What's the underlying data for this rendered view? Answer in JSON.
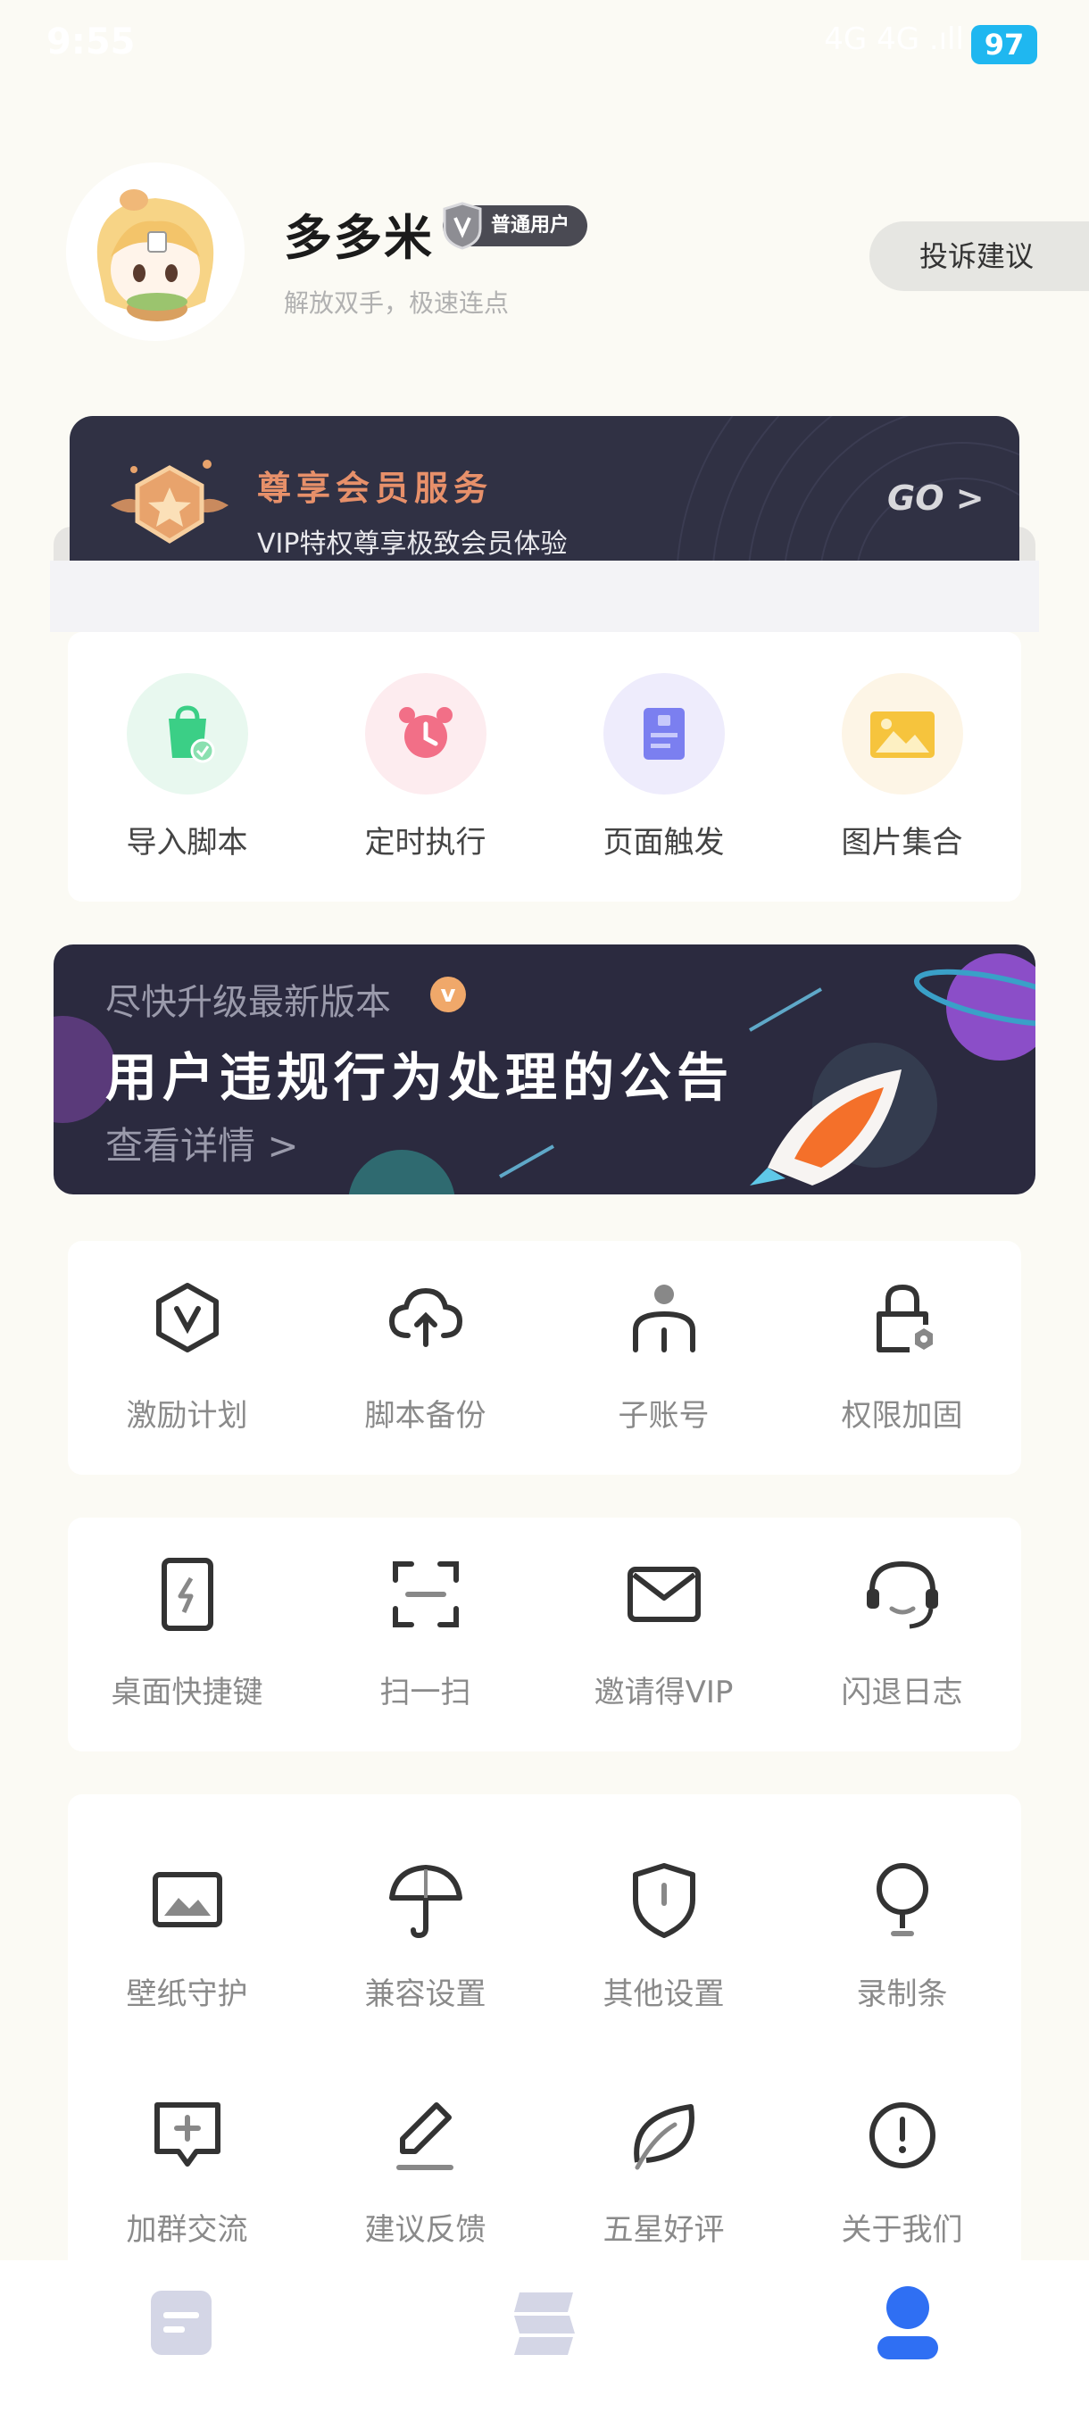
{
  "status_bar": {
    "time": "9:55",
    "signal": "4G 4G .ıll",
    "battery": "97"
  },
  "profile": {
    "username": "多多米",
    "badge": "普通用户",
    "slogan": "解放双手，极速连点",
    "complaint_button": "投诉建议"
  },
  "vip": {
    "title": "尊享会员服务",
    "subtitle": "VIP特权尊享极致会员体验",
    "go": "GO >"
  },
  "quick_actions": [
    {
      "label": "导入脚本",
      "icon": "import-script-icon",
      "bg": "#e8f8ef"
    },
    {
      "label": "定时执行",
      "icon": "alarm-clock-icon",
      "bg": "#fdecef"
    },
    {
      "label": "页面触发",
      "icon": "page-trigger-icon",
      "bg": "#eeecfc"
    },
    {
      "label": "图片集合",
      "icon": "image-collection-icon",
      "bg": "#fdf5e6"
    }
  ],
  "notice": {
    "subtitle": "尽快升级最新版本",
    "vip_mark": "v",
    "title": "用户违规行为处理的公告",
    "link": "查看详情 >"
  },
  "features_row1": [
    {
      "label": "激励计划",
      "icon": "incentive-plan-icon"
    },
    {
      "label": "脚本备份",
      "icon": "cloud-backup-icon"
    },
    {
      "label": "子账号",
      "icon": "sub-account-icon"
    },
    {
      "label": "权限加固",
      "icon": "permission-lock-icon"
    }
  ],
  "features_row2": [
    {
      "label": "桌面快捷键",
      "icon": "desktop-shortcut-icon"
    },
    {
      "label": "扫一扫",
      "icon": "scan-icon"
    },
    {
      "label": "邀请得VIP",
      "icon": "invite-mail-icon"
    },
    {
      "label": "闪退日志",
      "icon": "crash-log-headset-icon"
    }
  ],
  "features_row3": [
    {
      "label": "壁纸守护",
      "icon": "wallpaper-icon"
    },
    {
      "label": "兼容设置",
      "icon": "umbrella-icon"
    },
    {
      "label": "其他设置",
      "icon": "shield-icon"
    },
    {
      "label": "录制条",
      "icon": "record-bar-icon"
    }
  ],
  "features_row4": [
    {
      "label": "加群交流",
      "icon": "group-chat-icon"
    },
    {
      "label": "建议反馈",
      "icon": "edit-feedback-icon"
    },
    {
      "label": "五星好评",
      "icon": "leaf-icon"
    },
    {
      "label": "关于我们",
      "icon": "info-icon"
    }
  ],
  "bottom_nav": [
    {
      "name": "scripts-tab",
      "icon": "document-icon",
      "active": false
    },
    {
      "name": "market-tab",
      "icon": "layers-icon",
      "active": false
    },
    {
      "name": "profile-tab",
      "icon": "user-icon",
      "active": true
    }
  ],
  "colors": {
    "accent": "#2f6ff3",
    "vip_title": "#e7906a",
    "nav_inactive": "#d4d6e6"
  }
}
